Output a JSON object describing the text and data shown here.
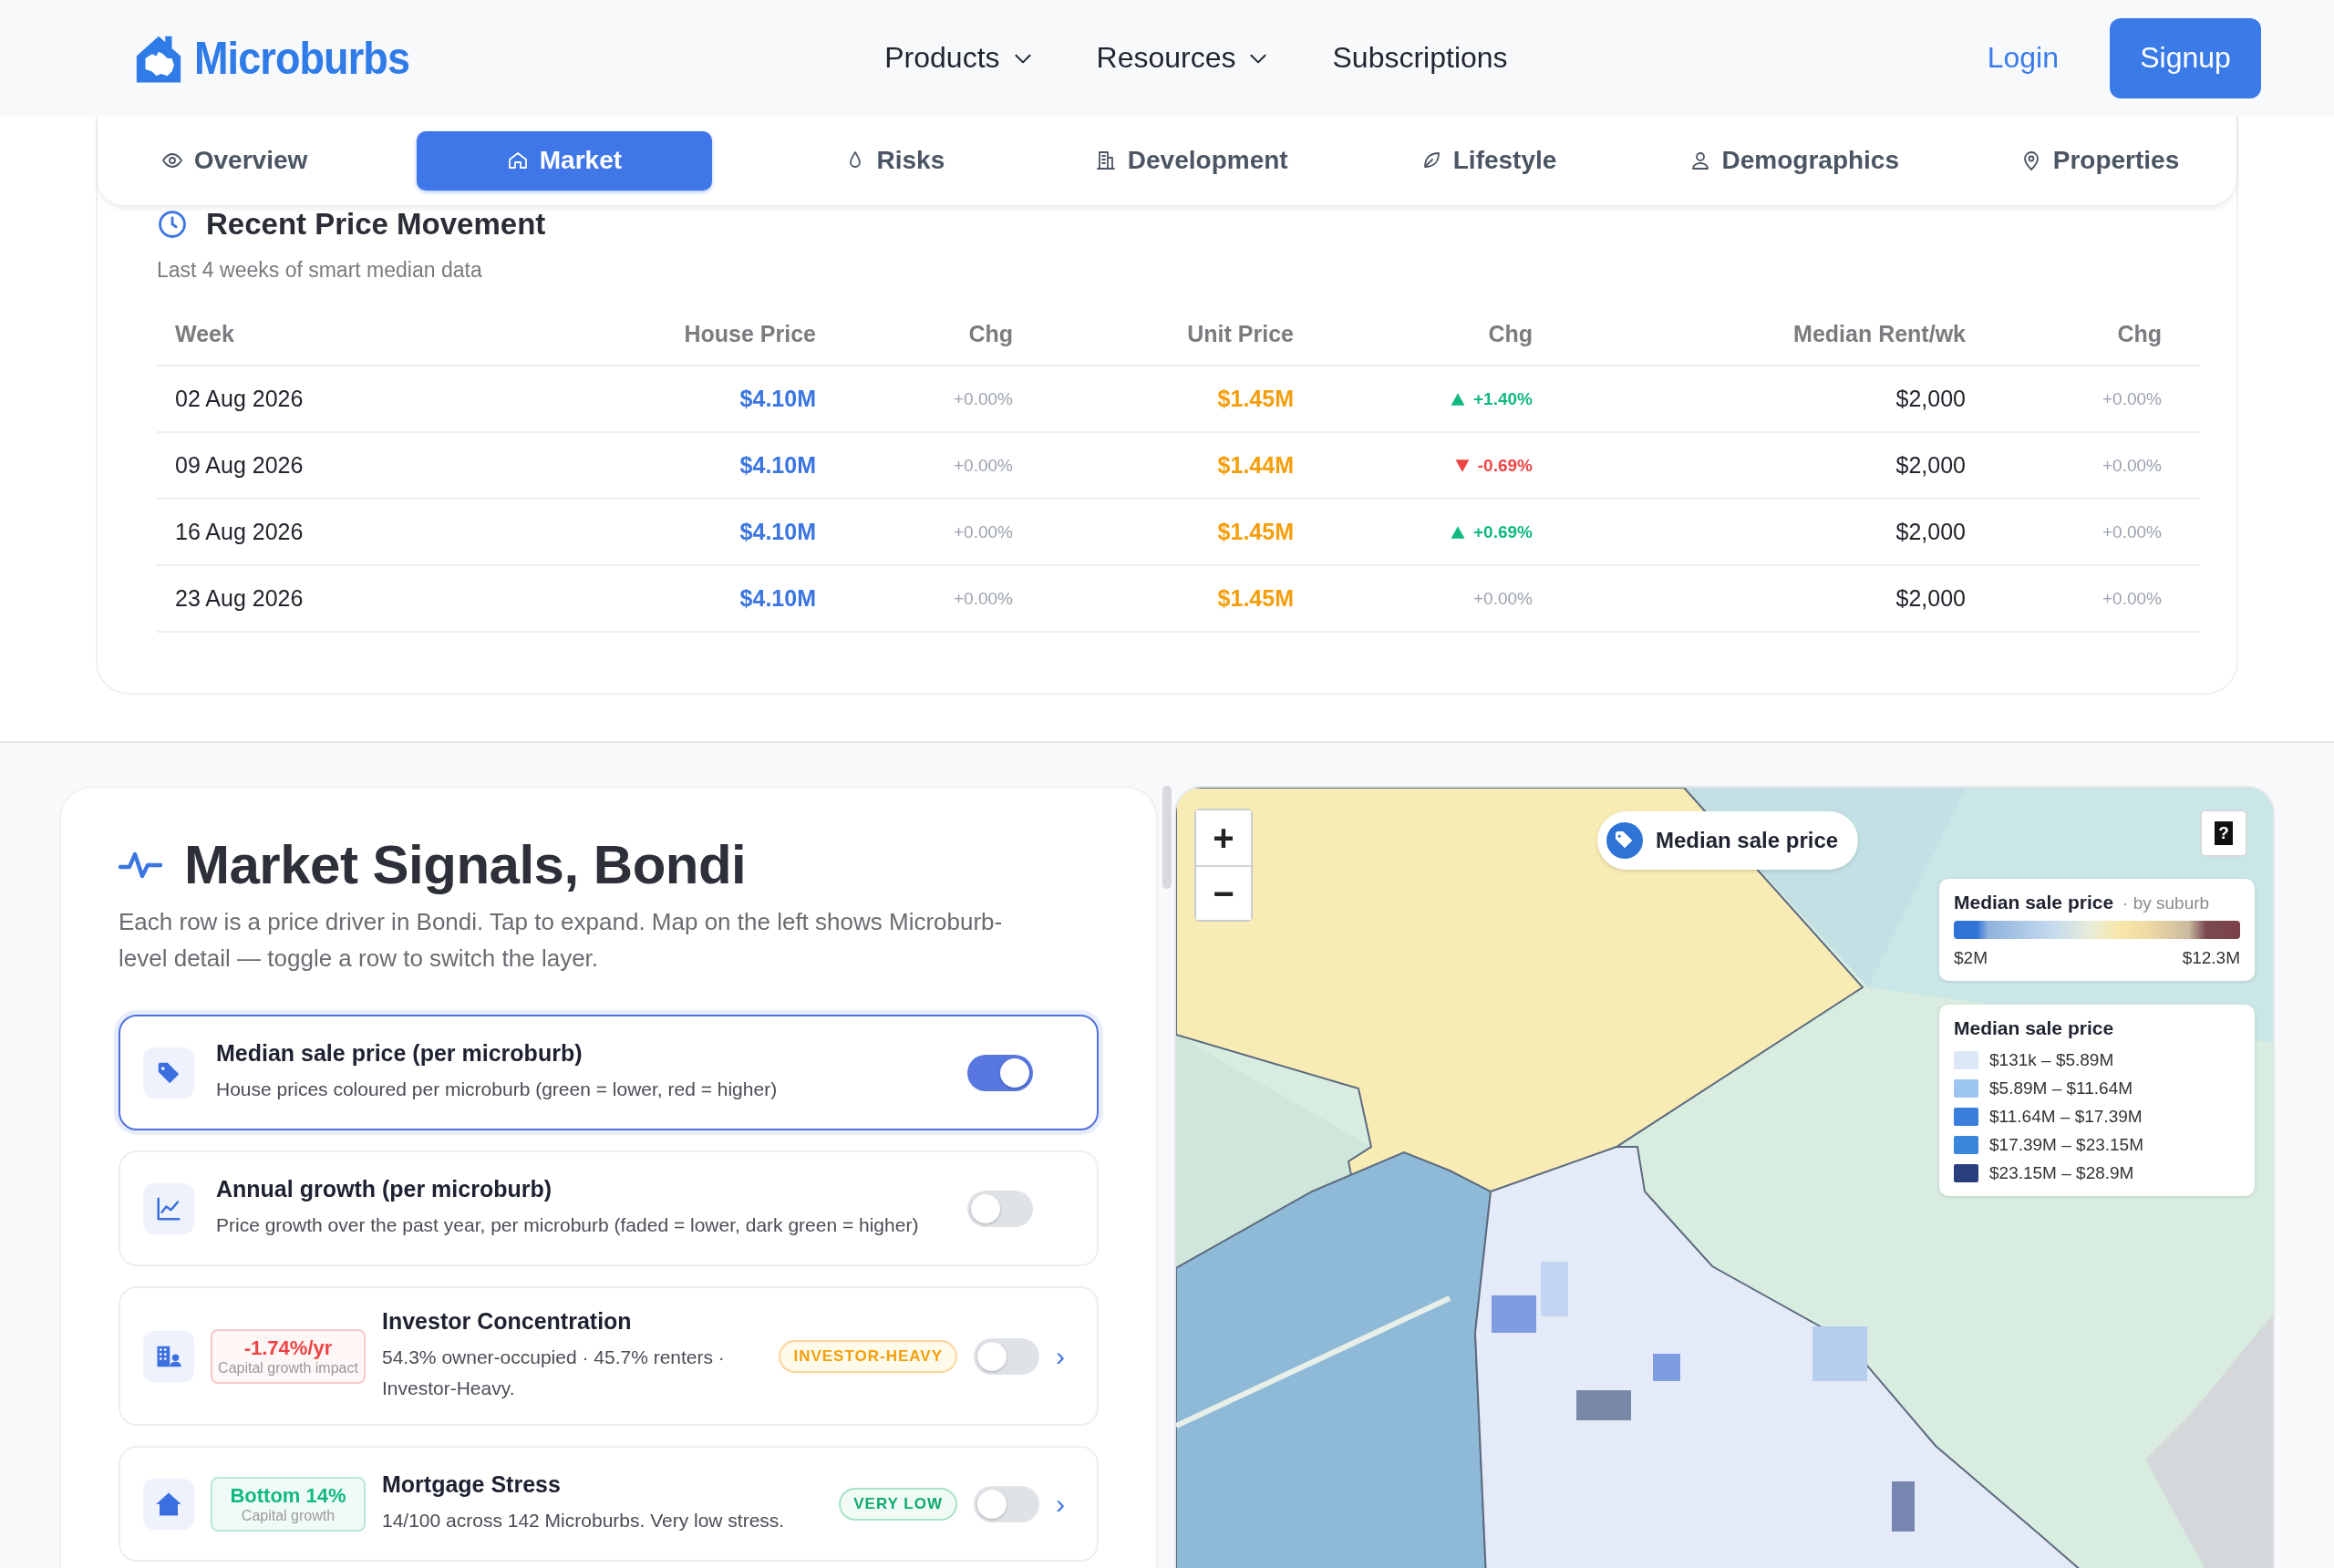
{
  "header": {
    "logo": "Microburbs",
    "nav": [
      {
        "label": "Products",
        "dropdown": true
      },
      {
        "label": "Resources",
        "dropdown": true
      },
      {
        "label": "Subscriptions",
        "dropdown": false
      }
    ],
    "login": "Login",
    "signup": "Signup"
  },
  "tabs": [
    {
      "label": "Overview",
      "selected": false
    },
    {
      "label": "Market",
      "selected": true
    },
    {
      "label": "Risks",
      "selected": false
    },
    {
      "label": "Development",
      "selected": false
    },
    {
      "label": "Lifestyle",
      "selected": false
    },
    {
      "label": "Demographics",
      "selected": false
    },
    {
      "label": "Properties",
      "selected": false
    }
  ],
  "price_movement": {
    "title": "Recent Price Movement",
    "subtitle": "Last 4 weeks of smart median data",
    "columns": [
      "Week",
      "House Price",
      "Chg",
      "Unit Price",
      "Chg",
      "Median Rent/wk",
      "Chg"
    ],
    "rows": [
      {
        "cells": [
          {
            "kind": "date",
            "text": "02 Aug 2026"
          },
          {
            "kind": "house",
            "text": "$4.10M"
          },
          {
            "kind": "flat",
            "text": "+0.00%"
          },
          {
            "kind": "unit",
            "text": "$1.45M"
          },
          {
            "kind": "up",
            "text": "+1.40%"
          },
          {
            "kind": "rent",
            "text": "$2,000"
          },
          {
            "kind": "flat",
            "text": "+0.00%"
          }
        ]
      },
      {
        "cells": [
          {
            "kind": "date",
            "text": "09 Aug 2026"
          },
          {
            "kind": "house",
            "text": "$4.10M"
          },
          {
            "kind": "flat",
            "text": "+0.00%"
          },
          {
            "kind": "unit",
            "text": "$1.44M"
          },
          {
            "kind": "down",
            "text": "-0.69%"
          },
          {
            "kind": "rent",
            "text": "$2,000"
          },
          {
            "kind": "flat",
            "text": "+0.00%"
          }
        ]
      },
      {
        "cells": [
          {
            "kind": "date",
            "text": "16 Aug 2026"
          },
          {
            "kind": "house",
            "text": "$4.10M"
          },
          {
            "kind": "flat",
            "text": "+0.00%"
          },
          {
            "kind": "unit",
            "text": "$1.45M"
          },
          {
            "kind": "up",
            "text": "+0.69%"
          },
          {
            "kind": "rent",
            "text": "$2,000"
          },
          {
            "kind": "flat",
            "text": "+0.00%"
          }
        ]
      },
      {
        "cells": [
          {
            "kind": "date",
            "text": "23 Aug 2026"
          },
          {
            "kind": "house",
            "text": "$4.10M"
          },
          {
            "kind": "flat",
            "text": "+0.00%"
          },
          {
            "kind": "unit",
            "text": "$1.45M"
          },
          {
            "kind": "flat",
            "text": "+0.00%"
          },
          {
            "kind": "rent",
            "text": "$2,000"
          },
          {
            "kind": "flat",
            "text": "+0.00%"
          }
        ]
      }
    ]
  },
  "market_signals": {
    "title": "Market Signals, Bondi",
    "description": "Each row is a price driver in Bondi. Tap to expand. Map on the left shows Microburb-level detail — toggle a row to switch the layer.",
    "rows": [
      {
        "kind": "layer",
        "title": "Median sale price (per microburb)",
        "description": "House prices coloured per microburb (green = lower, red = higher)",
        "selected": true,
        "on": true
      },
      {
        "kind": "layer",
        "title": "Annual growth (per microburb)",
        "description": "Price growth over the past year, per microburb (faded = lower, dark green = higher)",
        "selected": false,
        "on": false
      },
      {
        "kind": "signal",
        "badge": {
          "kind": "negative",
          "value": "-1.74%/yr",
          "label": "Capital growth impact"
        },
        "title": "Investor Concentration",
        "description": "54.3% owner-occupied · 45.7% renters · Investor-Heavy.",
        "tag": {
          "kind": "warning",
          "text": "INVESTOR-HEAVY"
        },
        "on": false,
        "chevron": "›"
      },
      {
        "kind": "signal",
        "badge": {
          "kind": "positive",
          "value": "Bottom 14%",
          "label": "Capital growth"
        },
        "title": "Mortgage Stress",
        "description": "14/100 across 142 Microburbs. Very low stress.",
        "tag": {
          "kind": "good",
          "text": "VERY LOW"
        },
        "on": false,
        "chevron": "›"
      }
    ]
  },
  "map": {
    "kind": "picture",
    "zoom_in": "+",
    "zoom_out": "−",
    "chip": "Median sale price",
    "help": "?",
    "scale_legend": {
      "title": "Median sale price",
      "subtitle": "· by suburb",
      "min": "$2M",
      "max": "$12.3M"
    },
    "class_legend": {
      "title": "Median sale price",
      "items": [
        {
          "label": "$131k – $5.89M",
          "color": "#dce8f8"
        },
        {
          "label": "$5.89M – $11.64M",
          "color": "#9cc6ef"
        },
        {
          "label": "$11.64M – $17.39M",
          "color": "#3b7fdc"
        },
        {
          "label": "$17.39M – $23.15M",
          "color": "#3a86dd"
        },
        {
          "label": "$23.15M – $28.9M",
          "color": "#2b3f7e"
        }
      ]
    }
  }
}
